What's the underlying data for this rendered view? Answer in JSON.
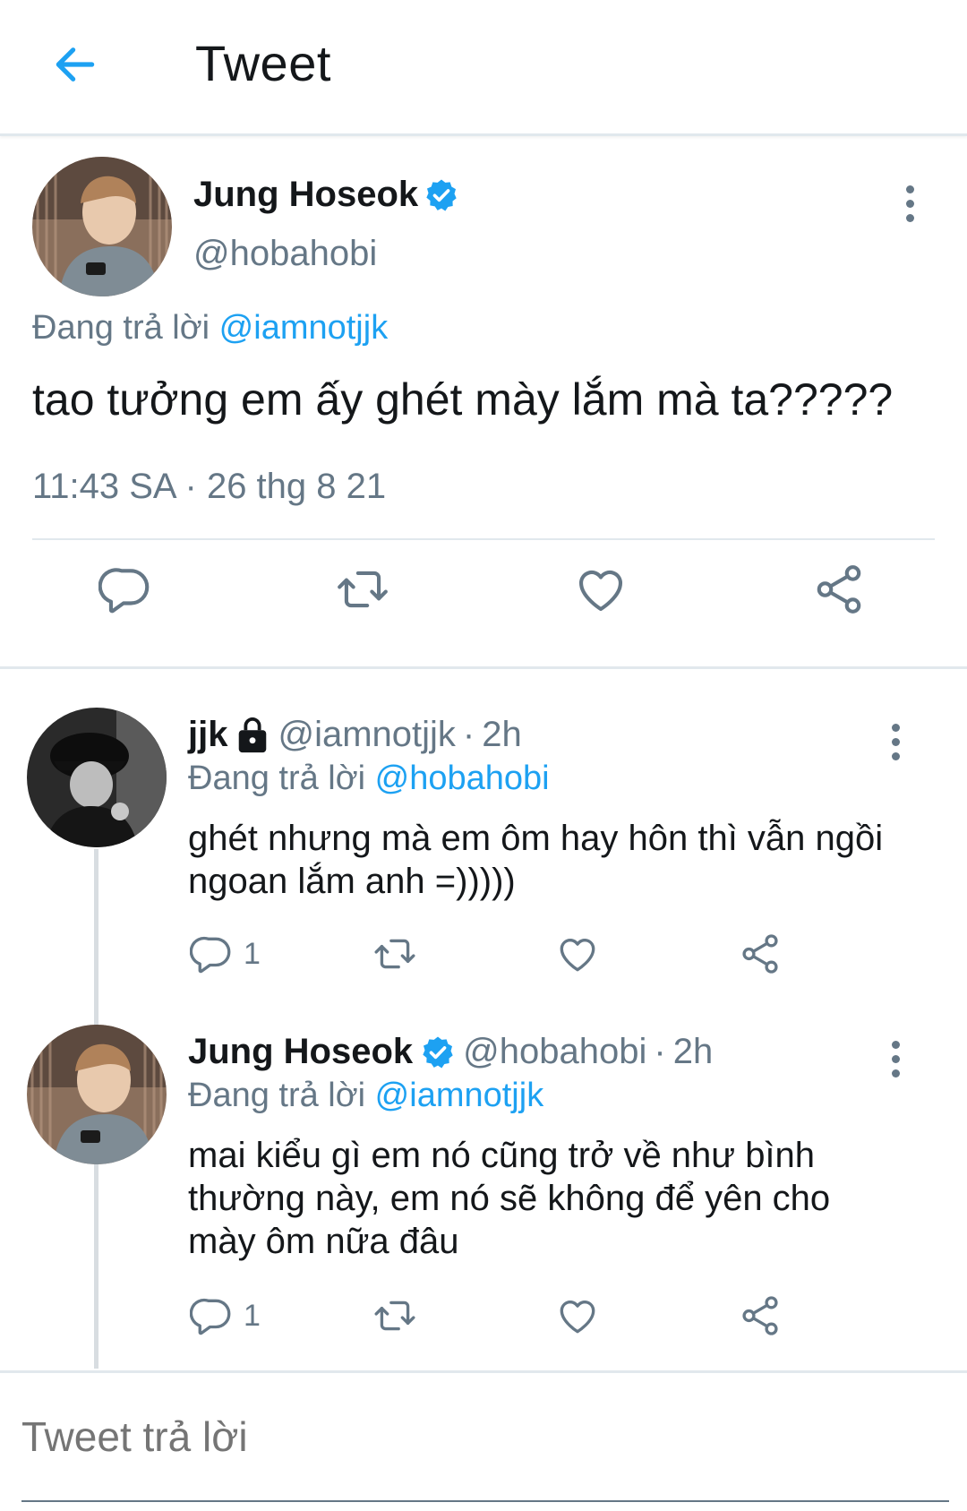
{
  "header": {
    "title": "Tweet"
  },
  "main_tweet": {
    "name": "Jung Hoseok",
    "handle": "@hobahobi",
    "reply_prefix": "Đang trả lời",
    "reply_mention": "@iamnotjjk",
    "text": "tao tưởng em ấy ghét mày lắm mà ta?????",
    "timestamp": "11:43 SA · 26 thg 8 21"
  },
  "replies": [
    {
      "name": "jjk",
      "handle": "@iamnotjjk",
      "separator": "·",
      "time": "2h",
      "reply_prefix": "Đang trả lời",
      "reply_mention": "@hobahobi",
      "text": "ghét nhưng mà em ôm hay hôn thì vẫn ngồi ngoan lắm anh =)))))",
      "reply_count": "1"
    },
    {
      "name": "Jung Hoseok",
      "handle": "@hobahobi",
      "separator": "·",
      "time": "2h",
      "reply_prefix": "Đang trả lời",
      "reply_mention": "@iamnotjjk",
      "text": "mai kiểu gì em nó cũng trở về như bình thường này, em nó sẽ không để yên cho mày ôm nữa đâu",
      "reply_count": "1"
    }
  ],
  "compose": {
    "placeholder": "Tweet trả lời"
  },
  "colors": {
    "accent": "#1da1f2",
    "secondary_text": "#657786",
    "icon": "#4a5a68"
  },
  "icons": [
    "back-arrow-icon",
    "verified-badge-icon",
    "more-icon",
    "lock-icon",
    "reply-icon",
    "retweet-icon",
    "like-icon",
    "share-icon"
  ]
}
